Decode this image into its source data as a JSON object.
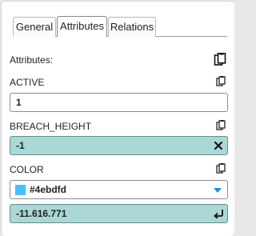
{
  "tabs": {
    "general": "General",
    "attributes": "Attributes",
    "relations": "Relations",
    "active": "attributes"
  },
  "attributes_header": {
    "label": "Attributes:"
  },
  "fields": {
    "active": {
      "label": "ACTIVE",
      "value": "1"
    },
    "breach_height": {
      "label": "BREACH_HEIGHT",
      "value": "-1"
    },
    "color": {
      "label": "COLOR",
      "value": "#4ebdfd",
      "swatch_color": "#4ebdfd",
      "secondary_value": "-11.616.771"
    }
  },
  "icons": {
    "copy": "copy-icon",
    "clear": "clear-icon",
    "dropdown": "dropdown-arrow-icon",
    "reset": "reset-icon"
  },
  "colors": {
    "field_highlight": "#a9d8d6",
    "dropdown_arrow": "#1f8fd8"
  }
}
